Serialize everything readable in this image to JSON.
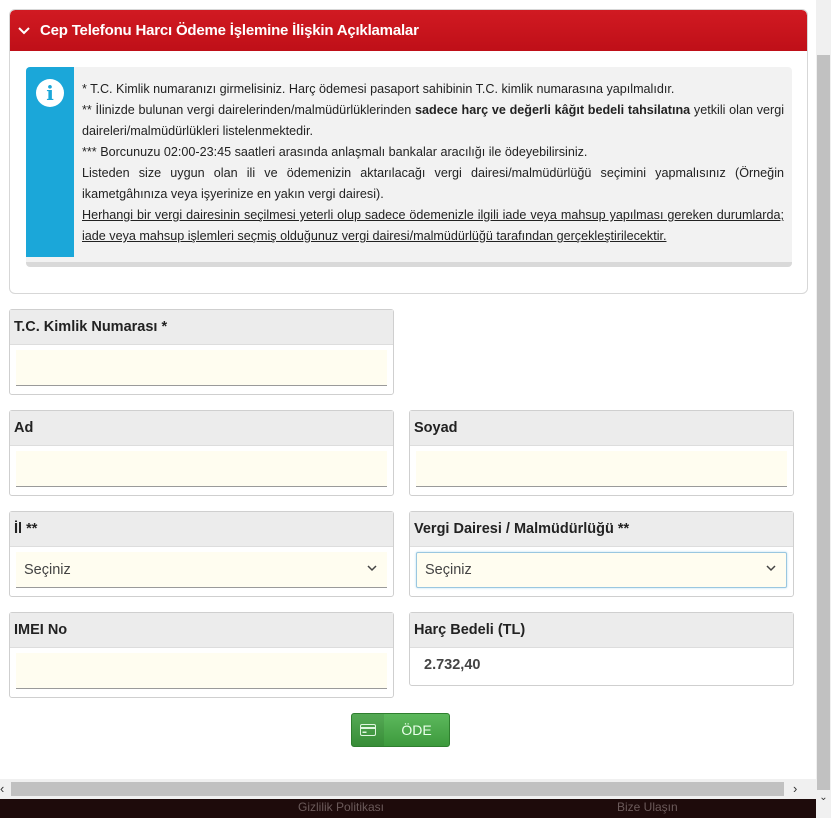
{
  "accordion": {
    "title": "Cep Telefonu Harcı Ödeme İşlemine İlişkin Açıklamalar",
    "lines": [
      "* T.C. Kimlik numaranızı girmelisiniz. Harç ödemesi pasaport sahibinin T.C. kimlik numarasına yapılmalıdır.",
      "** İlinizde bulunan vergi dairelerinden/malmüdürlüklerinden ",
      "sadece harç ve değerli kâğıt bedeli tahsilatına",
      " yetkili olan vergi daireleri/malmüdürlükleri listelenmektedir.",
      "*** Borcunuzu 02:00-23:45 saatleri arasında anlaşmalı bankalar aracılığı ile ödeyebilirsiniz.",
      "Listeden size uygun olan ili ve ödemenizin aktarılacağı vergi dairesi/malmüdürlüğü seçimini yapmalısınız (Örneğin ikametgâhınıza veya işyerinize en yakın vergi dairesi).",
      "Herhangi bir vergi dairesinin seçilmesi yeterli olup sadece ödemenizle ilgili iade veya mahsup yapılması gereken durumlarda; iade veya mahsup işlemleri seçmiş olduğunuz vergi dairesi/malmüdürlüğü tarafından gerçekleştirilecektir."
    ]
  },
  "form": {
    "tc_label": "T.C. Kimlik Numarası *",
    "tc_value": "",
    "ad_label": "Ad",
    "ad_value": "",
    "soyad_label": "Soyad",
    "soyad_value": "",
    "il_label": "İl **",
    "il_selected": "Seçiniz",
    "vergi_label": "Vergi Dairesi / Malmüdürlüğü **",
    "vergi_selected": "Seçiniz",
    "imei_label": "IMEI No",
    "imei_value": "",
    "harc_label": "Harç Bedeli (TL)",
    "harc_value": "2.732,40"
  },
  "pay_button": {
    "label": "ÖDE",
    "icon": "credit-card-icon"
  },
  "footer": {
    "left": "Gizlilik Politikası",
    "right": "Bize Ulaşın"
  },
  "colors": {
    "header_red": "#c8121b",
    "info_blue": "#1ba7d9",
    "button_green": "#4cae4c",
    "input_bg": "#fffdf0"
  }
}
